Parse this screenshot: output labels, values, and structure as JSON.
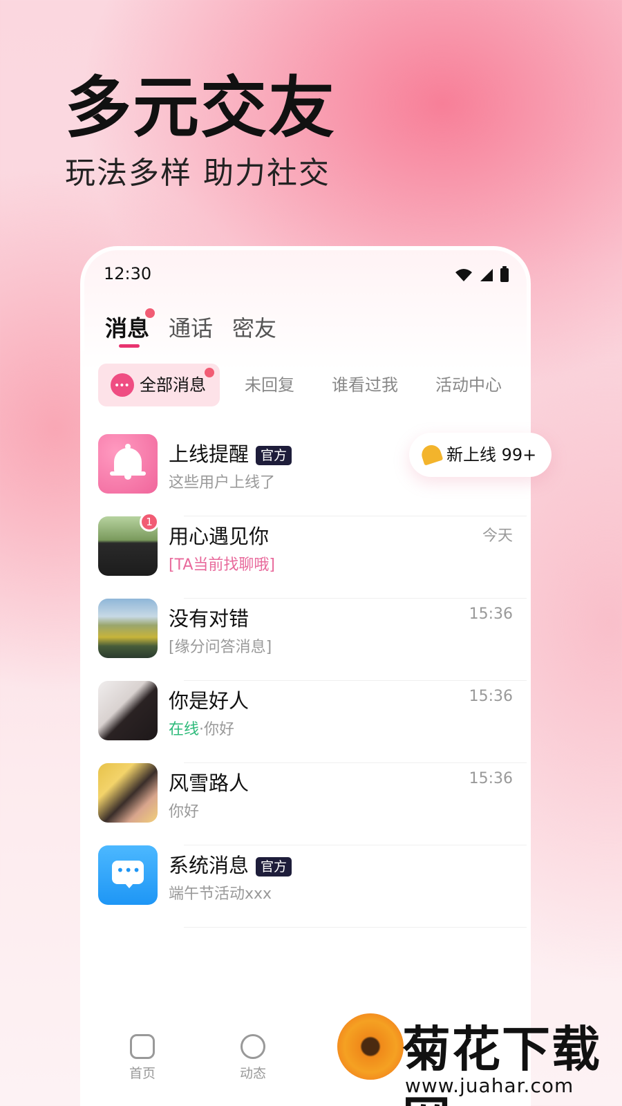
{
  "hero": {
    "title": "多元交友",
    "subtitle": "玩法多样 助力社交"
  },
  "status_bar": {
    "time": "12:30"
  },
  "top_tabs": [
    {
      "label": "消息",
      "active": true,
      "has_dot": true
    },
    {
      "label": "通话",
      "active": false
    },
    {
      "label": "密友",
      "active": false
    }
  ],
  "sub_tabs": [
    {
      "label": "全部消息",
      "active": true,
      "has_dot": true
    },
    {
      "label": "未回复"
    },
    {
      "label": "谁看过我"
    },
    {
      "label": "活动中心"
    }
  ],
  "online_pill": {
    "label": "新上线 99+",
    "icon": "bell-icon"
  },
  "messages": [
    {
      "name": "上线提醒",
      "tag": "官方",
      "preview": "这些用户上线了",
      "time": "",
      "avatar": "bell-icon"
    },
    {
      "name": "用心遇见你",
      "preview": "[TA当前找聊哦]",
      "time": "今天",
      "unread": "1",
      "avatar": "user-photo"
    },
    {
      "name": "没有对错",
      "preview": "[缘分问答消息]",
      "time": "15:36",
      "avatar": "landscape-photo"
    },
    {
      "name": "你是好人",
      "online_label": "在线",
      "preview": "·你好",
      "time": "15:36",
      "avatar": "user-photo"
    },
    {
      "name": "风雪路人",
      "preview": "你好",
      "time": "15:36",
      "avatar": "user-photo"
    },
    {
      "name": "系统消息",
      "tag": "官方",
      "preview": "端午节活动xxx",
      "time": "",
      "avatar": "chat-bubble-icon"
    }
  ],
  "bottom_nav": [
    {
      "label": "首页",
      "icon": "home-icon"
    },
    {
      "label": "动态",
      "icon": "moments-icon"
    }
  ],
  "watermark": {
    "title": "菊花下载网",
    "url": "www.juahar.com"
  },
  "colors": {
    "accent": "#e8336f",
    "badge": "#f15c74",
    "official_tag": "#1e1d3a",
    "online_green": "#2dba7a",
    "preview_pink": "#e8699b"
  }
}
